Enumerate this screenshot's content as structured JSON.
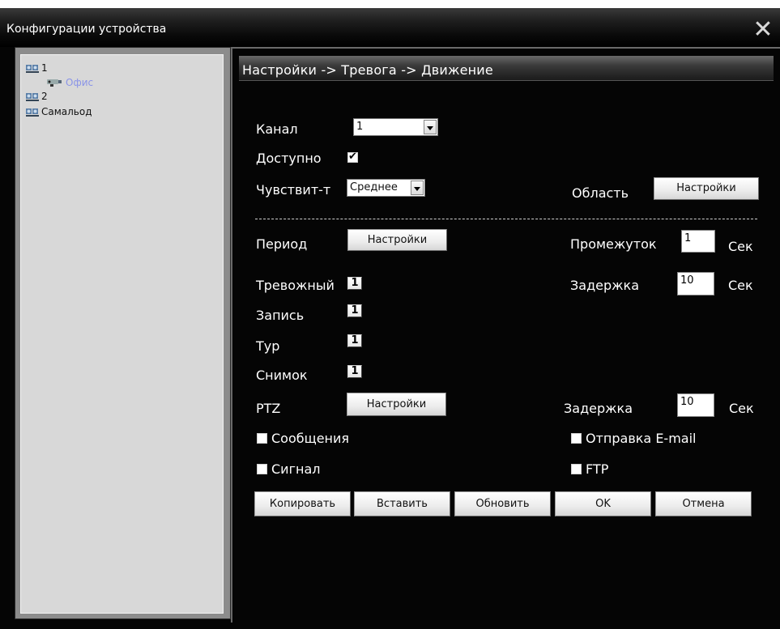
{
  "window": {
    "title": "Конфигурации устройства"
  },
  "tree": {
    "items": [
      {
        "label": "1",
        "level": 0,
        "icon": "camera-group-icon"
      },
      {
        "label": "Офис",
        "level": 1,
        "icon": "camera-icon"
      },
      {
        "label": "2",
        "level": 0,
        "icon": "camera-group-icon"
      },
      {
        "label": "Самальод",
        "level": 0,
        "icon": "camera-group-icon"
      }
    ]
  },
  "header": {
    "breadcrumb": "Настройки -> Тревога -> Движение"
  },
  "form": {
    "channel_label": "Канал",
    "channel_value": "1",
    "enabled_label": "Доступно",
    "enabled": true,
    "sensitivity_label": "Чувствит-т",
    "sensitivity_value": "Среднее",
    "area_label": "Область",
    "area_button": "Настройки",
    "period_label": "Период",
    "period_button": "Настройки",
    "interval_label": "Промежуток",
    "interval_value": "1",
    "interval_unit": "Сек",
    "alarm_label": "Тревожный",
    "alarm_channel": "1",
    "delay_label": "Задержка",
    "delay_value": "10",
    "delay_unit": "Сек",
    "record_label": "Запись",
    "record_channel": "1",
    "tour_label": "Тур",
    "tour_channel": "1",
    "snapshot_label": "Снимок",
    "snapshot_channel": "1",
    "ptz_label": "PTZ",
    "ptz_button": "Настройки",
    "ptz_delay_label": "Задержка",
    "ptz_delay_value": "10",
    "ptz_delay_unit": "Сек",
    "messages_label": "Сообщения",
    "messages_checked": false,
    "email_label": "Отправка E-mail",
    "email_checked": false,
    "beep_label": "Сигнал",
    "beep_checked": false,
    "ftp_label": "FTP",
    "ftp_checked": false
  },
  "buttons": {
    "copy": "Копировать",
    "paste": "Вставить",
    "refresh": "Обновить",
    "ok": "OK",
    "cancel": "Отмена"
  },
  "colors": {
    "background": "#050505",
    "tree_bg": "#d8d8d8",
    "tree_child": "#8a94e8"
  }
}
